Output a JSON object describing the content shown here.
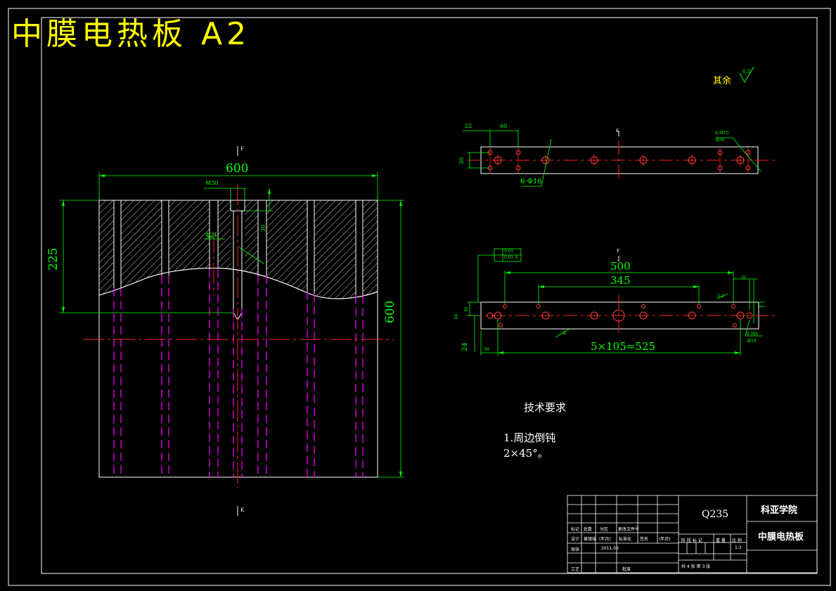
{
  "header": {
    "title": "中膜电热板 A2"
  },
  "roughness": {
    "label": "其余",
    "value": "6.3"
  },
  "main_view": {
    "dim_width": "600",
    "dim_height": "600",
    "dim_depth": "225",
    "thread": "M30",
    "thread_depth": "30",
    "hole_dia": "Φ24",
    "section_top": "F",
    "section_bottom": "K"
  },
  "top_view": {
    "dim_22": "22",
    "dim_60": "60",
    "dim_30": "30",
    "holes": "6-Φ16",
    "holes_right": "8-M15",
    "holes_right_depth": "深30",
    "section": "K"
  },
  "front_view": {
    "section": "F",
    "tol_flat": "0.05",
    "tol_par": "0.05 A",
    "dim_500": "500",
    "dim_345": "345",
    "dim_pitch": "5×105=525",
    "dim_10": "10",
    "dim_24": "24",
    "dim_left": "38",
    "dim_h1": "30",
    "dim_h2": "60",
    "holes_right": "6-M8",
    "holes_right_depth": "深18",
    "datum": "A",
    "rough_small": "3.2"
  },
  "tech": {
    "heading": "技术要求",
    "item1": "1.周边倒钝",
    "item2": "2×45°。"
  },
  "title_block": {
    "material": "Q235",
    "school": "科亚学院",
    "part_name": "中膜电热板",
    "r_biaoji": "标记",
    "r_chushu": "处数",
    "r_fenqu": "分区",
    "r_wenjian": "更改文件号",
    "r_sheji": "设计",
    "r_name": "黄镇瑞",
    "r_nianyue": "(年月)",
    "r_biaozhun": "标准化",
    "r_nianyue2": "(年月)",
    "r_shenhe": "审核",
    "r_date": "2011.06",
    "r_gongyi": "工艺",
    "r_pizhun": "批准",
    "r_qianming": "签名",
    "stage": "阶 段 标 记",
    "weight": "重 量",
    "scale": "比 例",
    "scale_val": "1:2",
    "sheets": "共 4 张  第 3 张"
  }
}
